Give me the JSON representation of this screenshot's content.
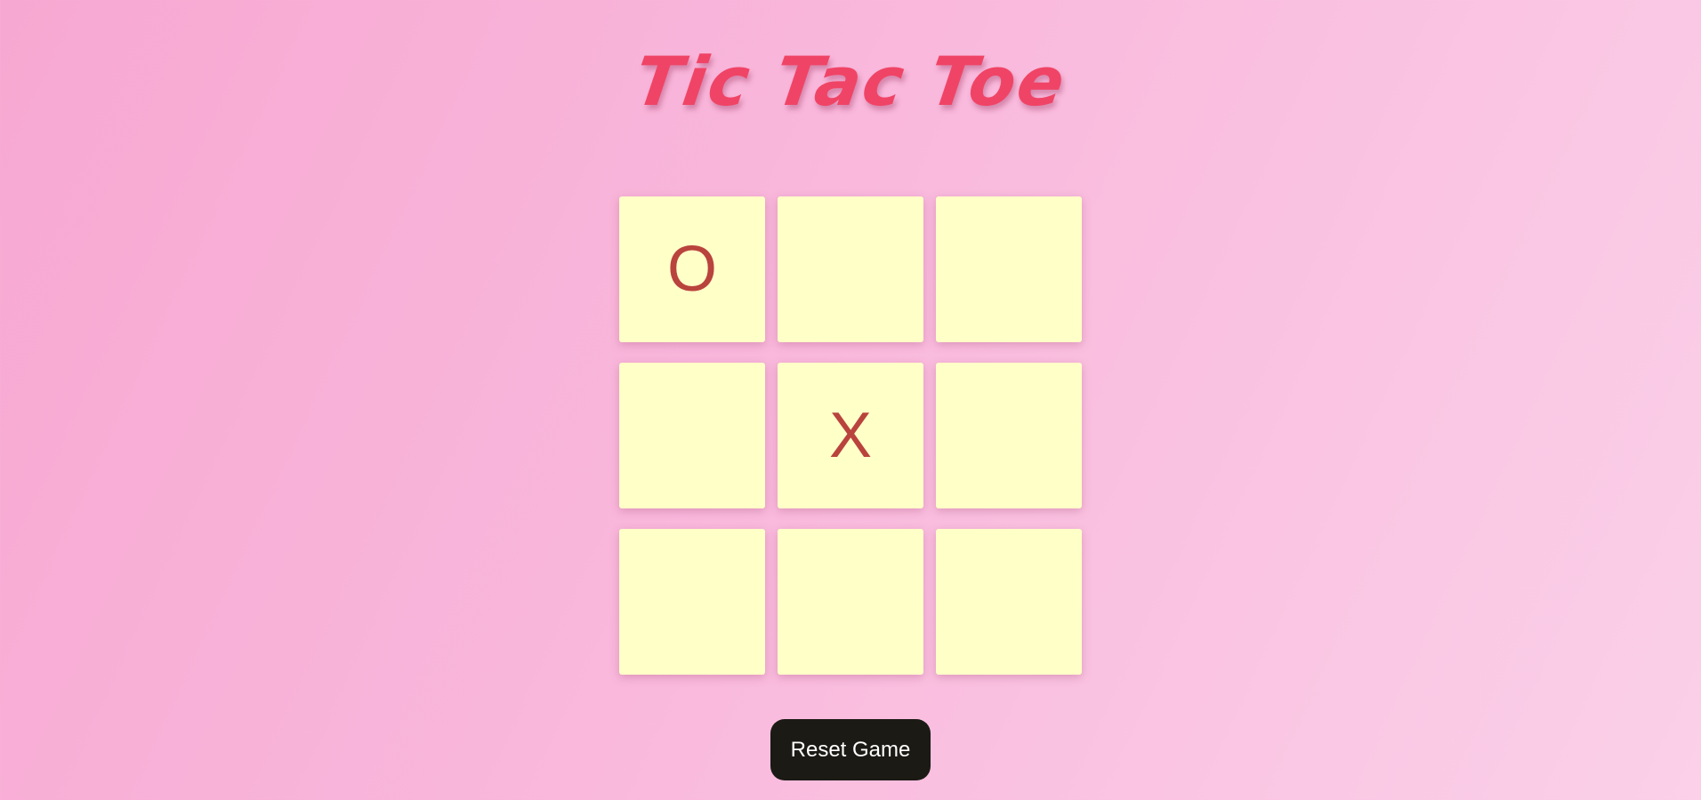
{
  "title": "Tic Tac Toe",
  "board": {
    "cells": [
      "O",
      "",
      "",
      "",
      "X",
      "",
      "",
      "",
      ""
    ]
  },
  "controls": {
    "reset_label": "Reset Game"
  },
  "colors": {
    "title": "#f04466",
    "cell_background": "#ffffc8",
    "mark": "#b9433d",
    "button_background": "#1b1a15",
    "button_text": "#ffffff"
  }
}
